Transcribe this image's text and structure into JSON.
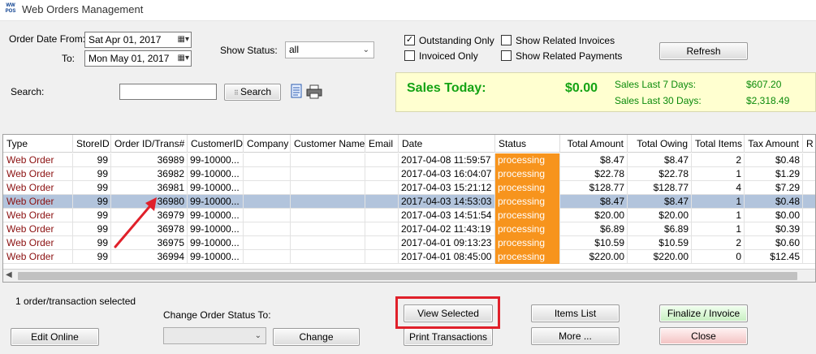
{
  "window": {
    "icon_text": "WW POS",
    "title": "Web Orders Management"
  },
  "filters": {
    "date_from_label": "Order Date From:",
    "date_from_value": "Sat   Apr 01, 2017",
    "date_to_label": "To:",
    "date_to_value": "Mon  May 01, 2017",
    "show_status_label": "Show Status:",
    "show_status_value": "all",
    "outstanding_only": {
      "label": "Outstanding Only",
      "checked": true,
      "mark": "✓"
    },
    "invoiced_only": {
      "label": "Invoiced Only",
      "checked": false
    },
    "show_related_invoices": {
      "label": "Show Related Invoices",
      "checked": false
    },
    "show_related_payments": {
      "label": "Show Related Payments",
      "checked": false
    },
    "refresh_label": "Refresh"
  },
  "search": {
    "label": "Search:",
    "value": "",
    "button_label": "Search"
  },
  "sales": {
    "today_label": "Sales Today:",
    "today_value": "$0.00",
    "last7_label": "Sales Last 7 Days:",
    "last7_value": "$607.20",
    "last30_label": "Sales Last 30 Days:",
    "last30_value": "$2,318.49"
  },
  "grid": {
    "columns": [
      "Type",
      "StoreID",
      "Order ID/Trans#",
      "CustomerID",
      "Company",
      "Customer Name",
      "Email",
      "Date",
      "Status",
      "Total Amount",
      "Total Owing",
      "Total Items",
      "Tax Amount",
      "R"
    ],
    "rows": [
      [
        "Web Order",
        "99",
        "36989",
        "99-10000...",
        "",
        "",
        "",
        "2017-04-08 11:59:57",
        "processing",
        "$8.47",
        "$8.47",
        "2",
        "$0.48"
      ],
      [
        "Web Order",
        "99",
        "36982",
        "99-10000...",
        "",
        "",
        "",
        "2017-04-03 16:04:07",
        "processing",
        "$22.78",
        "$22.78",
        "1",
        "$1.29"
      ],
      [
        "Web Order",
        "99",
        "36981",
        "99-10000...",
        "",
        "",
        "",
        "2017-04-03 15:21:12",
        "processing",
        "$128.77",
        "$128.77",
        "4",
        "$7.29"
      ],
      [
        "Web Order",
        "99",
        "36980",
        "99-10000...",
        "",
        "",
        "",
        "2017-04-03 14:53:03",
        "processing",
        "$8.47",
        "$8.47",
        "1",
        "$0.48"
      ],
      [
        "Web Order",
        "99",
        "36979",
        "99-10000...",
        "",
        "",
        "",
        "2017-04-03 14:51:54",
        "processing",
        "$20.00",
        "$20.00",
        "1",
        "$0.00"
      ],
      [
        "Web Order",
        "99",
        "36978",
        "99-10000...",
        "",
        "",
        "",
        "2017-04-02 11:43:19",
        "processing",
        "$6.89",
        "$6.89",
        "1",
        "$0.39"
      ],
      [
        "Web Order",
        "99",
        "36975",
        "99-10000...",
        "",
        "",
        "",
        "2017-04-01 09:13:23",
        "processing",
        "$10.59",
        "$10.59",
        "2",
        "$0.60"
      ],
      [
        "Web Order",
        "99",
        "36994",
        "99-10000...",
        "",
        "",
        "",
        "2017-04-01 08:45:00",
        "processing",
        "$220.00",
        "$220.00",
        "0",
        "$12.45"
      ]
    ],
    "selected_row": 3
  },
  "footer": {
    "selection_text": "1 order/transaction selected",
    "change_status_label": "Change Order Status To:",
    "change_status_value": "",
    "buttons": {
      "edit_online": "Edit Online",
      "change": "Change",
      "view_selected": "View Selected",
      "print_transactions": "Print Transactions",
      "items_list": "Items List",
      "more": "More ...",
      "finalize": "Finalize / Invoice",
      "close": "Close"
    }
  },
  "colors": {
    "status_processing": "#f7941d",
    "sales_green": "#14a314",
    "annotation_red": "#e0202a",
    "selected_row": "#b2c4dc"
  }
}
